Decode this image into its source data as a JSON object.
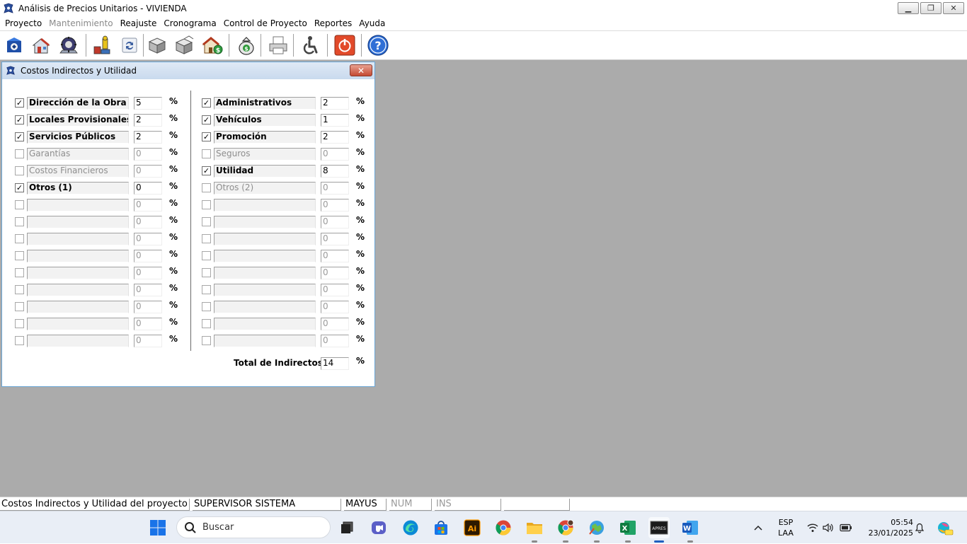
{
  "window": {
    "title": "Análisis de Precios Unitarios  -  VIVIENDA",
    "app_icon": "app-logo-icon",
    "buttons": [
      "minimize",
      "restore",
      "close"
    ]
  },
  "menu": {
    "items": [
      "Proyecto",
      "Mantenimiento",
      "Reajuste",
      "Cronograma",
      "Control de Proyecto",
      "Reportes",
      "Ayuda"
    ]
  },
  "toolbar": {
    "icons": [
      "open-project-icon",
      "project-house-icon",
      "maintenance-gear-icon",
      "resources-icon",
      "refresh-icon",
      "boxes-icon",
      "boxes-open-icon",
      "house-cost-icon",
      "money-bag-icon",
      "printer-icon",
      "accessibility-icon",
      "power-icon",
      "help-icon"
    ]
  },
  "dialog": {
    "title": "Costos Indirectos y Utilidad",
    "close_label": "✕",
    "percent_symbol": "%",
    "left": [
      {
        "label": "Dirección de la Obra",
        "value": "5",
        "checked": true
      },
      {
        "label": "Locales Provisionales",
        "value": "2",
        "checked": true
      },
      {
        "label": "Servicios Públicos",
        "value": "2",
        "checked": true
      },
      {
        "label": "Garantías",
        "value": "0",
        "checked": false
      },
      {
        "label": "Costos Financieros",
        "value": "0",
        "checked": false
      },
      {
        "label": "Otros (1)",
        "value": "0",
        "checked": true
      },
      {
        "label": "",
        "value": "0",
        "checked": false
      },
      {
        "label": "",
        "value": "0",
        "checked": false
      },
      {
        "label": "",
        "value": "0",
        "checked": false
      },
      {
        "label": "",
        "value": "0",
        "checked": false
      },
      {
        "label": "",
        "value": "0",
        "checked": false
      },
      {
        "label": "",
        "value": "0",
        "checked": false
      },
      {
        "label": "",
        "value": "0",
        "checked": false
      },
      {
        "label": "",
        "value": "0",
        "checked": false
      },
      {
        "label": "",
        "value": "0",
        "checked": false
      }
    ],
    "right": [
      {
        "label": "Administrativos",
        "value": "2",
        "checked": true
      },
      {
        "label": "Vehículos",
        "value": "1",
        "checked": true
      },
      {
        "label": "Promoción",
        "value": "2",
        "checked": true
      },
      {
        "label": "Seguros",
        "value": "0",
        "checked": false
      },
      {
        "label": "Utilidad",
        "value": "8",
        "checked": true
      },
      {
        "label": "Otros (2)",
        "value": "0",
        "checked": false
      },
      {
        "label": "",
        "value": "0",
        "checked": false
      },
      {
        "label": "",
        "value": "0",
        "checked": false
      },
      {
        "label": "",
        "value": "0",
        "checked": false
      },
      {
        "label": "",
        "value": "0",
        "checked": false
      },
      {
        "label": "",
        "value": "0",
        "checked": false
      },
      {
        "label": "",
        "value": "0",
        "checked": false
      },
      {
        "label": "",
        "value": "0",
        "checked": false
      },
      {
        "label": "",
        "value": "0",
        "checked": false
      },
      {
        "label": "",
        "value": "0",
        "checked": false
      }
    ],
    "total_label": "Total de Indirectos :",
    "total_value": "14"
  },
  "statusbar": {
    "description": "Costos Indirectos y Utilidad del proyecto",
    "user": "SUPERVISOR SISTEMA",
    "caps": "MAYUS",
    "num": "NUM",
    "ins": "INS"
  },
  "taskbar": {
    "search_placeholder": "Buscar",
    "apps": [
      "task-view-icon",
      "teams-icon",
      "edge-icon",
      "store-icon",
      "illustrator-icon",
      "chrome-icon",
      "file-explorer-icon",
      "chrome-profile-icon",
      "maps-icon",
      "excel-icon",
      "apu-app-icon",
      "word-icon"
    ],
    "illustrator_label": "Ai",
    "excel_label": "X",
    "word_label": "W",
    "apu_label": "APRES",
    "language": "ESP",
    "keyboard": "LAA",
    "time": "05:54",
    "date": "23/01/2025"
  }
}
